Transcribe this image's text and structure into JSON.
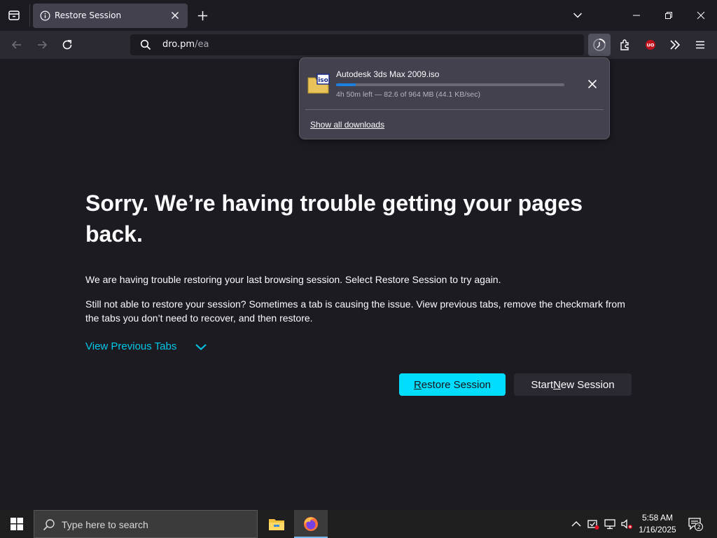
{
  "browser": {
    "tab": {
      "title": "Restore Session"
    },
    "url": {
      "host": "dro.pm",
      "path": "/ea"
    }
  },
  "download_panel": {
    "filename": "Autodesk 3ds Max 2009.iso",
    "status": "4h 50m left — 82.6 of 964 MB (44.1 KB/sec)",
    "progress_fraction": 0.086,
    "file_icon_label": "iso",
    "show_all_label": "Show all downloads"
  },
  "page": {
    "title": "Sorry. We’re having trouble getting your pages back.",
    "para1": "We are having trouble restoring your last browsing session. Select Restore Session to try again.",
    "para2": "Still not able to restore your session? Sometimes a tab is causing the issue. View previous tabs, remove the checkmark from the tabs you don’t need to recover, and then restore.",
    "view_previous_tabs": "View Previous Tabs",
    "restore_button": {
      "pre": "",
      "ul": "R",
      "post": "estore Session"
    },
    "new_session_button": {
      "pre": "Start ",
      "ul": "N",
      "post": "ew Session"
    }
  },
  "taskbar": {
    "search_placeholder": "Type here to search",
    "time": "5:58 AM",
    "date": "1/16/2025",
    "notification_count": "2"
  },
  "colors": {
    "accent": "#00ddff",
    "link": "#00c8e8",
    "progress": "#1d7fe0",
    "background": "#1c1b22"
  },
  "icons": [
    "tab-list-icon",
    "info-icon",
    "close-icon",
    "plus-icon",
    "chevron-down-icon",
    "minimize-icon",
    "restore-icon",
    "back-arrow-icon",
    "forward-arrow-icon",
    "reload-icon",
    "search-icon",
    "downloads-icon",
    "extensions-icon",
    "ublock-icon",
    "overflow-icon",
    "menu-icon",
    "iso-file-icon",
    "windows-logo-icon",
    "file-explorer-icon",
    "firefox-icon",
    "chevron-up-icon",
    "network-icon",
    "volume-muted-icon",
    "notification-icon"
  ]
}
